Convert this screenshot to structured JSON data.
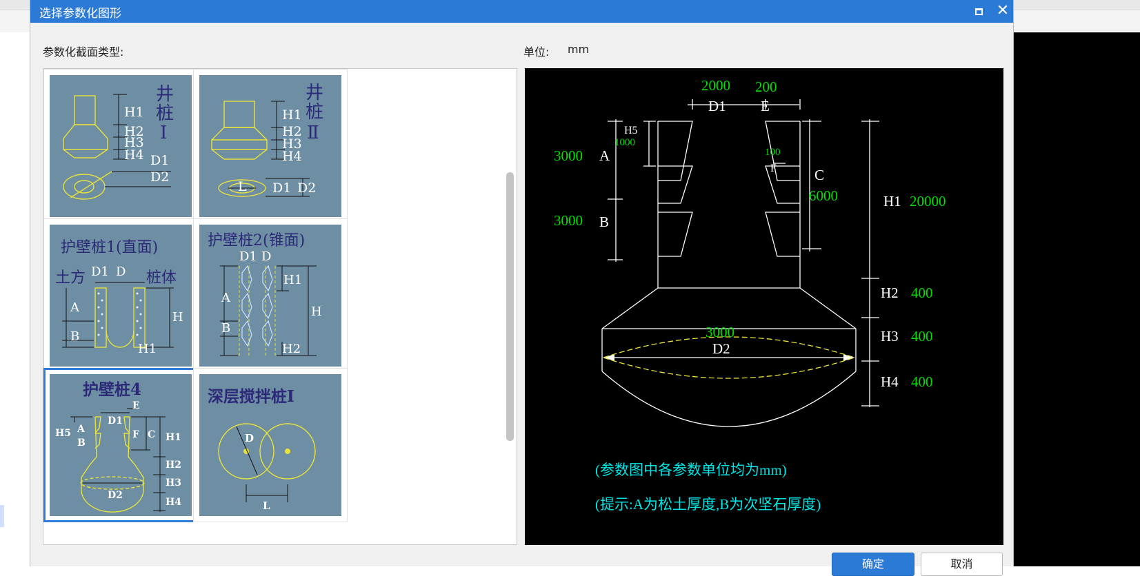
{
  "dialog": {
    "title": "选择参数化图形",
    "type_label": "参数化截面类型:",
    "unit_label": "单位:",
    "unit_value": "mm",
    "ok_label": "确定",
    "cancel_label": "取消"
  },
  "thumbnails": [
    {
      "name": "thumb-jingzhuang-1",
      "title": "井桩Ⅰ",
      "labels": [
        "井",
        "桩",
        "Ⅰ",
        "H1",
        "H2",
        "H3",
        "H4",
        "D1",
        "D2"
      ]
    },
    {
      "name": "thumb-jingzhuang-2",
      "title": "井桩Ⅱ",
      "labels": [
        "井",
        "桩",
        "Ⅱ",
        "H1",
        "H2",
        "H3",
        "H4",
        "L",
        "D1",
        "D2"
      ]
    },
    {
      "name": "thumb-hubizhuang-1",
      "title": "护壁桩1(直面)",
      "labels": [
        "土方",
        "D1",
        "D",
        "桩体",
        "A",
        "H",
        "B",
        "H1"
      ]
    },
    {
      "name": "thumb-hubizhuang-2",
      "title": "护壁桩2(锥面)",
      "labels": [
        "D1",
        "D",
        "H1",
        "A",
        "H",
        "B",
        "H2"
      ]
    },
    {
      "name": "thumb-hubizhuang-4",
      "title": "护壁桩4",
      "labels": [
        "E",
        "D1",
        "H5",
        "A",
        "F",
        "C",
        "H1",
        "B",
        "H2",
        "H3",
        "D2",
        "H4"
      ]
    },
    {
      "name": "thumb-shenceng-1",
      "title": "深层搅拌桩Ⅰ",
      "labels": [
        "D",
        "L"
      ]
    }
  ],
  "preview": {
    "dims": {
      "d1_value": "2000",
      "d1_label": "D1",
      "e_value": "200",
      "e_label": "E",
      "h5_label": "H5",
      "h5_value": "1000",
      "a_value": "3000",
      "a_label": "A",
      "b_value": "3000",
      "b_label": "B",
      "f_value": "100",
      "f_label": "F",
      "c_label": "C",
      "c_value": "6000",
      "h1_label": "H1",
      "h1_value": "20000",
      "h2_label": "H2",
      "h2_value": "400",
      "h3_label": "H3",
      "h3_value": "400",
      "h4_label": "H4",
      "h4_value": "400",
      "d2_value": "3000",
      "d2_label": "D2"
    },
    "note1": "(参数图中各参数单位均为mm)",
    "note2": "(提示:A为松土厚度,B为次坚石厚度)"
  },
  "colors": {
    "accent": "#2b7ad6",
    "thumb_bg": "#6d8ea3",
    "thumb_line": "#e8e23a",
    "preview_green": "#00e000",
    "preview_cyan": "#00e5e5"
  }
}
